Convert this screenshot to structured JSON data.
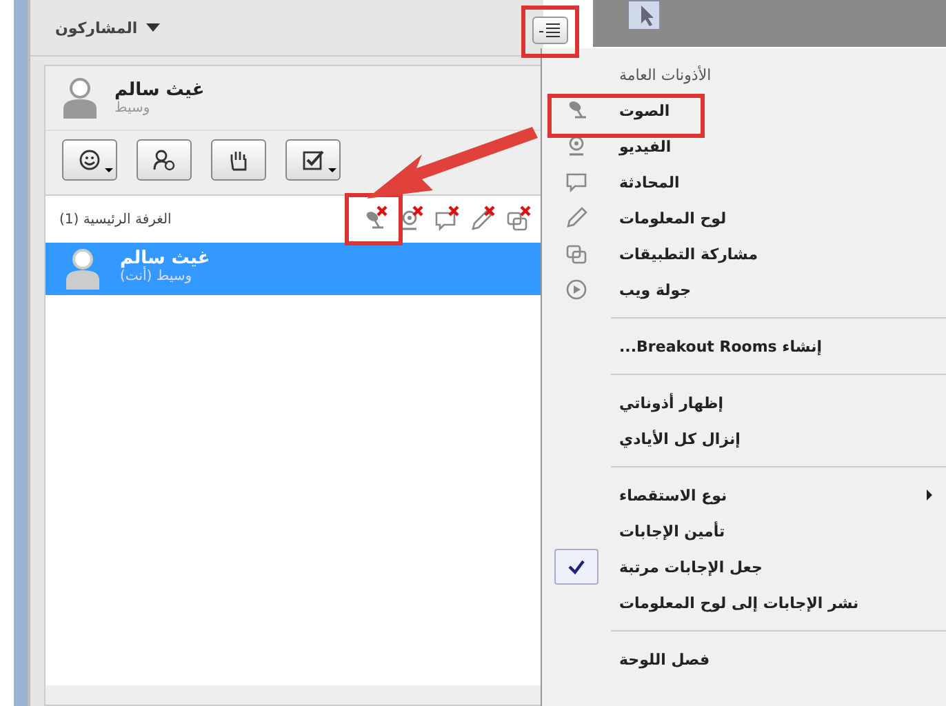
{
  "panel": {
    "title": "المشاركون",
    "presenter": {
      "name": "غيث سالم",
      "role": "وسيط"
    },
    "tools": [
      {
        "kind": "emoticon",
        "dropdown": true
      },
      {
        "kind": "away",
        "dropdown": false
      },
      {
        "kind": "hand",
        "dropdown": false
      },
      {
        "kind": "check",
        "dropdown": true
      }
    ],
    "room": {
      "title": "(1) الغرفة الرئيسية",
      "permissions": [
        {
          "kind": "audio",
          "denied": true
        },
        {
          "kind": "video",
          "denied": true
        },
        {
          "kind": "chat",
          "denied": true
        },
        {
          "kind": "whiteboard",
          "denied": true
        },
        {
          "kind": "apps",
          "denied": true
        }
      ]
    },
    "participants": [
      {
        "name": "غيث سالم",
        "role": "وسيط (أنت)",
        "selected": true
      }
    ]
  },
  "menu": {
    "items": [
      {
        "kind": "header",
        "label": "الأذونات العامة"
      },
      {
        "kind": "permission",
        "label": "الصوت"
      },
      {
        "kind": "permission",
        "label": "الفيديو"
      },
      {
        "kind": "permission",
        "label": "المحادثة"
      },
      {
        "kind": "permission",
        "label": "لوح المعلومات"
      },
      {
        "kind": "permission",
        "label": "مشاركة التطبيقات"
      },
      {
        "kind": "permission",
        "label": "جولة ويب"
      },
      {
        "kind": "separator"
      },
      {
        "kind": "item",
        "label": "إنشاء Breakout Rooms...",
        "checked": false,
        "submenu": false
      },
      {
        "kind": "separator"
      },
      {
        "kind": "item",
        "label": "إظهار أذوناتي",
        "checked": false,
        "submenu": false
      },
      {
        "kind": "item",
        "label": "إنزال كل الأيادي",
        "checked": false,
        "submenu": false
      },
      {
        "kind": "separator"
      },
      {
        "kind": "item",
        "label": "نوع الاستقصاء",
        "checked": false,
        "submenu": true
      },
      {
        "kind": "item",
        "label": "تأمين الإجابات",
        "checked": false,
        "submenu": false
      },
      {
        "kind": "item",
        "label": "جعل الإجابات مرتبة",
        "checked": true,
        "submenu": false
      },
      {
        "kind": "item",
        "label": "نشر الإجابات إلى لوح المعلومات",
        "checked": false,
        "submenu": false
      },
      {
        "kind": "separator"
      },
      {
        "kind": "item",
        "label": "فصل اللوحة",
        "checked": false,
        "submenu": false
      }
    ]
  }
}
